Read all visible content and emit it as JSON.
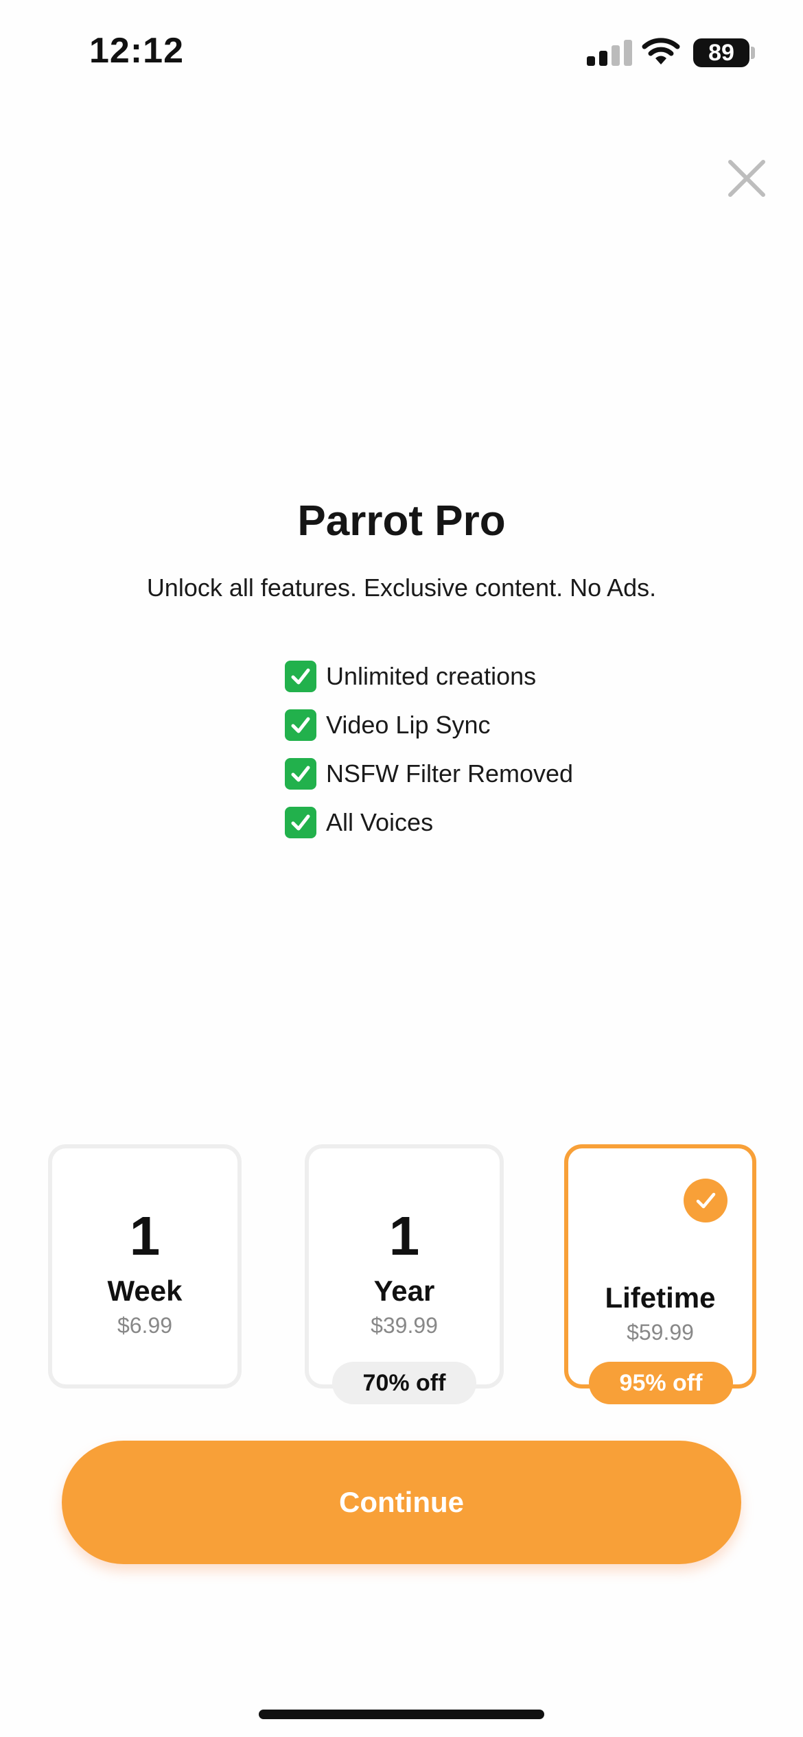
{
  "status_bar": {
    "time": "12:12",
    "battery": "89",
    "icons": [
      "cellular-signal-icon",
      "wifi-icon",
      "battery-icon"
    ]
  },
  "header": {
    "title": "Parrot Pro",
    "subtitle": "Unlock all features. Exclusive content. No Ads."
  },
  "features": [
    {
      "icon": "check-mark-button-icon",
      "label": "Unlimited creations"
    },
    {
      "icon": "check-mark-button-icon",
      "label": "Video Lip Sync"
    },
    {
      "icon": "check-mark-button-icon",
      "label": "NSFW Filter Removed"
    },
    {
      "icon": "check-mark-button-icon",
      "label": "All Voices"
    }
  ],
  "plans": [
    {
      "number": "1",
      "unit": "Week",
      "price": "$6.99",
      "badge": "",
      "selected": false
    },
    {
      "number": "1",
      "unit": "Year",
      "price": "$39.99",
      "badge": "70% off",
      "selected": false
    },
    {
      "number": "",
      "unit": "Lifetime",
      "price": "$59.99",
      "badge": "95% off",
      "selected": true
    }
  ],
  "continue_label": "Continue",
  "colors": {
    "accent": "#f8a038",
    "check_green": "#22b14c",
    "card_border": "#eeeeee",
    "price_gray": "#888888"
  }
}
